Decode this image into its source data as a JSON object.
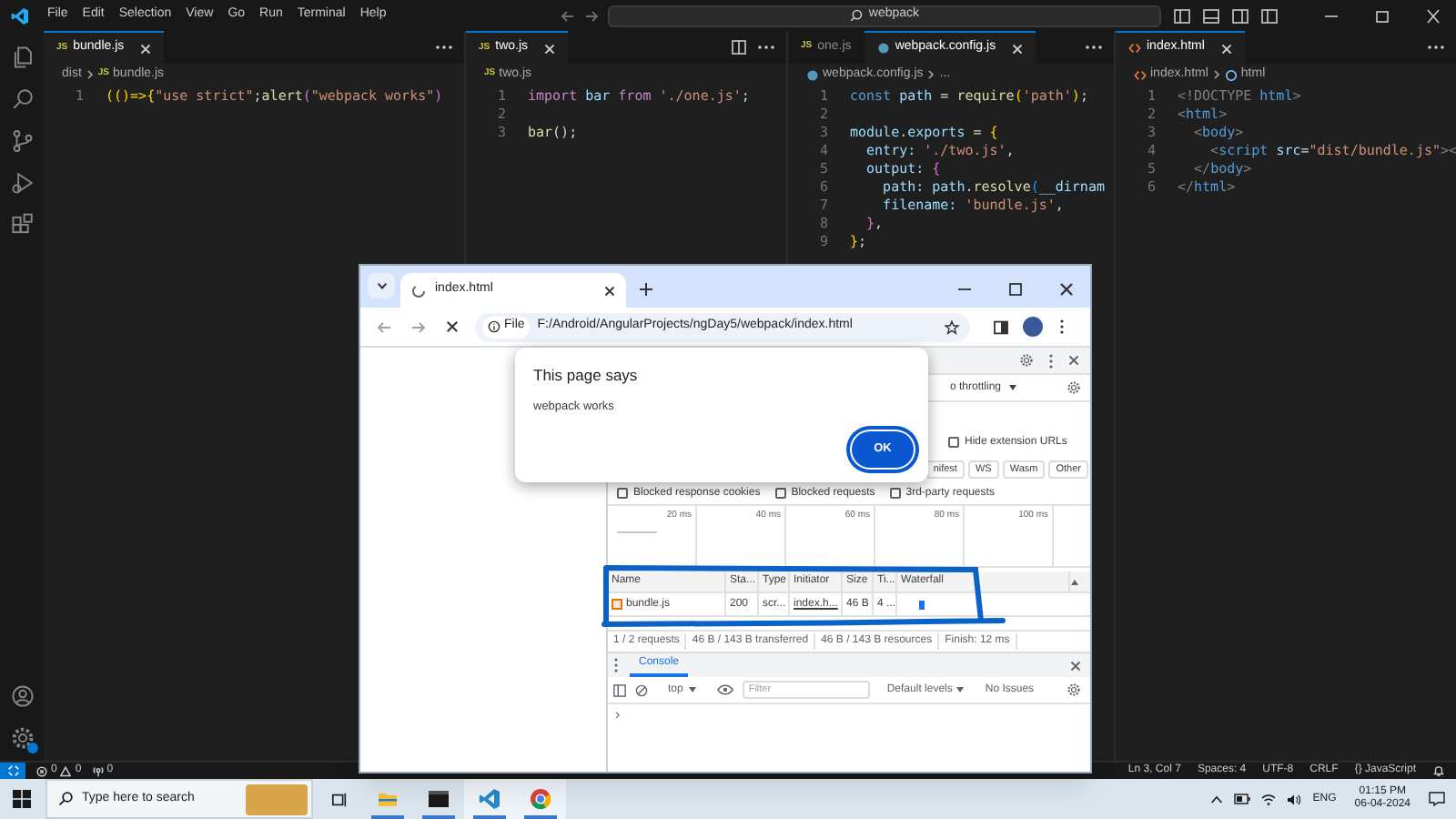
{
  "titlebar": {
    "menu": [
      "File",
      "Edit",
      "Selection",
      "View",
      "Go",
      "Run",
      "Terminal",
      "Help"
    ],
    "search": "webpack"
  },
  "editor_groups": [
    {
      "tabs": [
        {
          "label": "bundle.js",
          "kind": "js",
          "icon_text": "JS",
          "selected": true
        }
      ],
      "breadcrumb": [
        {
          "text": "dist",
          "kind": "folder"
        },
        {
          "text": "bundle.js",
          "kind": "js",
          "icon_text": "JS"
        }
      ],
      "lines": [
        {
          "number": "1",
          "tokens": [
            {
              "text": "(()=>{",
              "kind": "bracket"
            },
            {
              "text": "\"use strict\"",
              "kind": "string"
            },
            {
              "text": ";",
              "kind": "plain"
            },
            {
              "text": "alert",
              "kind": "function"
            },
            {
              "text": "(",
              "kind": "bracket2"
            },
            {
              "text": "\"webpack works\"",
              "kind": "string"
            },
            {
              "text": ")",
              "kind": "bracket2"
            }
          ]
        }
      ]
    },
    {
      "tabs": [
        {
          "label": "two.js",
          "kind": "js",
          "icon_text": "JS",
          "selected": true
        }
      ],
      "breadcrumb": [
        {
          "text": "two.js",
          "kind": "js",
          "icon_text": "JS"
        }
      ],
      "lines": [
        {
          "number": "1",
          "tokens": [
            {
              "text": "import ",
              "kind": "keyword"
            },
            {
              "text": "bar ",
              "kind": "variable"
            },
            {
              "text": "from ",
              "kind": "keyword"
            },
            {
              "text": "'./one.js'",
              "kind": "string"
            },
            {
              "text": ";",
              "kind": "plain"
            }
          ]
        },
        {
          "number": "2"
        },
        {
          "number": "3",
          "tokens": [
            {
              "text": "bar",
              "kind": "function"
            },
            {
              "text": "();",
              "kind": "plain"
            }
          ]
        }
      ]
    },
    {
      "tabs": [
        {
          "label": "one.js",
          "kind": "js",
          "icon_text": "JS",
          "selected": false
        },
        {
          "label": "webpack.config.js",
          "kind": "config",
          "selected": true
        }
      ],
      "breadcrumb": [
        {
          "text": "webpack.config.js",
          "kind": "config"
        },
        {
          "text": "...",
          "kind": "none"
        }
      ],
      "lines": [
        {
          "number": "1",
          "tokens": [
            {
              "text": "const ",
              "kind": "storage"
            },
            {
              "text": "path ",
              "kind": "variable"
            },
            {
              "text": "= ",
              "kind": "plain"
            },
            {
              "text": "require",
              "kind": "function"
            },
            {
              "text": "(",
              "kind": "bracket"
            },
            {
              "text": "'path'",
              "kind": "string"
            },
            {
              "text": ")",
              "kind": "bracket"
            },
            {
              "text": ";",
              "kind": "plain"
            }
          ]
        },
        {
          "number": "2"
        },
        {
          "number": "3",
          "tokens": [
            {
              "text": "module",
              "kind": "variable"
            },
            {
              "text": ".",
              "kind": "plain"
            },
            {
              "text": "exports ",
              "kind": "variable"
            },
            {
              "text": "= ",
              "kind": "plain"
            },
            {
              "text": "{",
              "kind": "bracket"
            }
          ]
        },
        {
          "number": "4",
          "tokens": [
            {
              "text": "  entry: ",
              "kind": "variable"
            },
            {
              "text": "'./two.js'",
              "kind": "string"
            },
            {
              "text": ",",
              "kind": "plain"
            }
          ]
        },
        {
          "number": "5",
          "tokens": [
            {
              "text": "  output: ",
              "kind": "variable"
            },
            {
              "text": "{",
              "kind": "bracket2"
            }
          ]
        },
        {
          "number": "6",
          "tokens": [
            {
              "text": "    path: ",
              "kind": "variable"
            },
            {
              "text": "path",
              "kind": "variable"
            },
            {
              "text": ".",
              "kind": "plain"
            },
            {
              "text": "resolve",
              "kind": "function"
            },
            {
              "text": "(",
              "kind": "bracket3"
            },
            {
              "text": "__dirnam",
              "kind": "variable"
            }
          ]
        },
        {
          "number": "7",
          "tokens": [
            {
              "text": "    filename: ",
              "kind": "variable"
            },
            {
              "text": "'bundle.js'",
              "kind": "string"
            },
            {
              "text": ",",
              "kind": "plain"
            }
          ]
        },
        {
          "number": "8",
          "tokens": [
            {
              "text": "  }",
              "kind": "bracket2"
            },
            {
              "text": ",",
              "kind": "plain"
            }
          ]
        },
        {
          "number": "9",
          "tokens": [
            {
              "text": "}",
              "kind": "bracket"
            },
            {
              "text": ";",
              "kind": "plain"
            }
          ]
        }
      ]
    },
    {
      "tabs": [
        {
          "label": "index.html",
          "kind": "html",
          "selected": true
        }
      ],
      "breadcrumb": [
        {
          "text": "index.html",
          "kind": "html"
        },
        {
          "text": "html",
          "kind": "element"
        }
      ],
      "lines": [
        {
          "number": "1",
          "tokens": [
            {
              "text": "<!DOCTYPE ",
              "kind": "tagpunct"
            },
            {
              "text": "html",
              "kind": "tag"
            },
            {
              "text": ">",
              "kind": "tagpunct"
            }
          ]
        },
        {
          "number": "2",
          "tokens": [
            {
              "text": "<",
              "kind": "tagpunct"
            },
            {
              "text": "html",
              "kind": "tag"
            },
            {
              "text": ">",
              "kind": "tagpunct"
            }
          ]
        },
        {
          "number": "3",
          "tokens": [
            {
              "text": "  <",
              "kind": "tagpunct"
            },
            {
              "text": "body",
              "kind": "tag"
            },
            {
              "text": ">",
              "kind": "tagpunct"
            }
          ]
        },
        {
          "number": "4",
          "tokens": [
            {
              "text": "    <",
              "kind": "tagpunct"
            },
            {
              "text": "script ",
              "kind": "tag"
            },
            {
              "text": "src",
              "kind": "attr"
            },
            {
              "text": "=",
              "kind": "plain"
            },
            {
              "text": "\"dist/bundle.js\"",
              "kind": "string"
            },
            {
              "text": "><",
              "kind": "tagpunct"
            }
          ]
        },
        {
          "number": "5",
          "tokens": [
            {
              "text": "  </",
              "kind": "tagpunct"
            },
            {
              "text": "body",
              "kind": "tag"
            },
            {
              "text": ">",
              "kind": "tagpunct"
            }
          ]
        },
        {
          "number": "6",
          "tokens": [
            {
              "text": "</",
              "kind": "tagpunct"
            },
            {
              "text": "html",
              "kind": "tag"
            },
            {
              "text": ">",
              "kind": "tagpunct"
            }
          ]
        }
      ]
    }
  ],
  "status_bar": {
    "errors": "0",
    "warnings": "0",
    "ports": "0",
    "items": [
      "Ln 3, Col 7",
      "Spaces: 4",
      "UTF-8",
      "CRLF",
      "{} JavaScript"
    ]
  },
  "browser": {
    "tab": "index.html",
    "chip": "File",
    "url": "F:/Android/AngularProjects/ngDay5/webpack/index.html",
    "dialog": {
      "title": "This page says",
      "message": "webpack works",
      "button": "OK"
    },
    "devtools": {
      "throttling": "o throttling",
      "hide_extension_urls": {
        "label": "Hide extension URLs",
        "checked": false
      },
      "filters": [
        "nifest",
        "WS",
        "Wasm",
        "Other"
      ],
      "checkboxes": [
        {
          "label": "Blocked response cookies",
          "checked": false
        },
        {
          "label": "Blocked requests",
          "checked": false
        },
        {
          "label": "3rd-party requests",
          "checked": false
        }
      ],
      "ticks": [
        "20 ms",
        "40 ms",
        "60 ms",
        "80 ms",
        "100 ms"
      ],
      "columns": [
        "Name",
        "Sta...",
        "Type",
        "Initiator",
        "Size",
        "Ti...",
        "Waterfall"
      ],
      "rows": [
        {
          "cells": [
            "bundle.js",
            "200",
            "scr...",
            "index.h...",
            "46 B",
            "4 ..."
          ]
        }
      ],
      "summary": [
        "1 / 2 requests",
        "46 B / 143 B transferred",
        "46 B / 143 B resources",
        "Finish: 12 ms"
      ],
      "drawer_tabs": [
        {
          "label": "Console",
          "selected": true
        }
      ],
      "context": "top",
      "filter_placeholder": "Filter",
      "levels": "Default levels",
      "issues": "No Issues",
      "prompt": "›"
    }
  },
  "taskbar": {
    "search_placeholder": "Type here to search",
    "apps": [
      {
        "kind": "files",
        "active": false
      },
      {
        "kind": "terminal",
        "active": false
      },
      {
        "kind": "vscode",
        "active": true
      },
      {
        "kind": "chrome",
        "active": true
      }
    ],
    "language": "ENG",
    "time": "01:15 PM",
    "date": "06-04-2024"
  }
}
